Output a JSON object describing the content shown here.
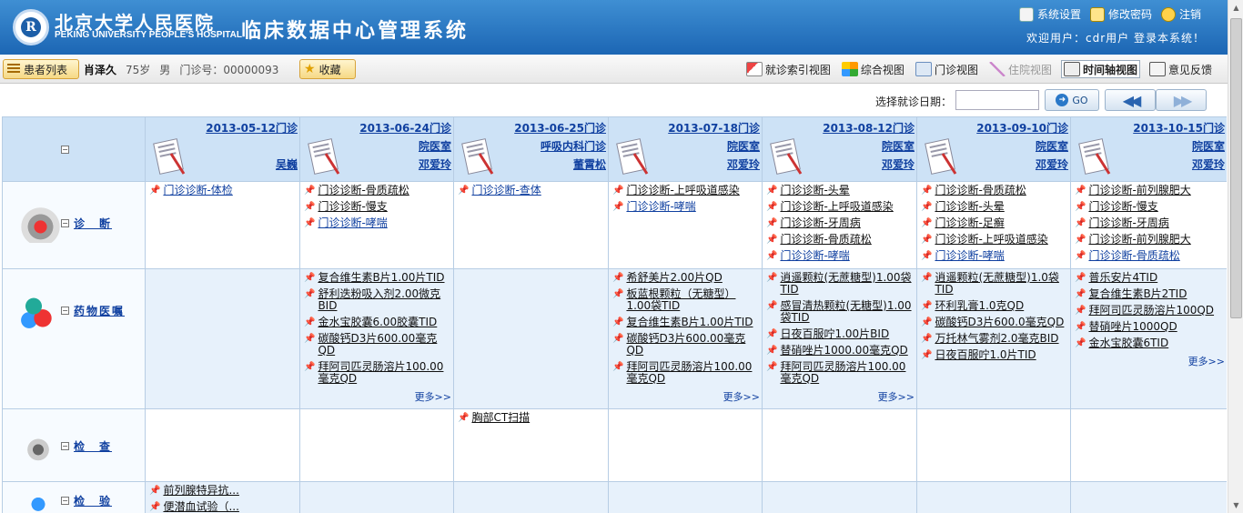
{
  "header": {
    "hospital_cn": "北京大学人民医院",
    "hospital_en": "PEKING UNIVERSITY PEOPLE'S HOSPITAL",
    "system_title": "临床数据中心管理系统",
    "links": [
      {
        "label": "系统设置",
        "icon": "settings-icon"
      },
      {
        "label": "修改密码",
        "icon": "edit-password-icon"
      },
      {
        "label": "注销",
        "icon": "logout-icon"
      }
    ],
    "welcome": "欢迎用户：cdr用户 登录本系统！"
  },
  "patient_bar": {
    "list_button": "患者列表",
    "name": "肖泽久",
    "age": "75岁",
    "sex": "男",
    "outpatient_no": "门诊号：00000093",
    "favorite_button": "收藏"
  },
  "views": [
    {
      "label": "就诊索引视图",
      "icon": "index-view-icon",
      "state": "normal"
    },
    {
      "label": "综合视图",
      "icon": "overview-icon",
      "state": "normal"
    },
    {
      "label": "门诊视图",
      "icon": "outpatient-view-icon",
      "state": "normal"
    },
    {
      "label": "住院视图",
      "icon": "inpatient-view-icon",
      "state": "disabled"
    },
    {
      "label": "时间轴视图",
      "icon": "timeline-view-icon",
      "state": "active"
    },
    {
      "label": "意见反馈",
      "icon": "feedback-icon",
      "state": "normal"
    }
  ],
  "date_bar": {
    "label": "选择就诊日期：",
    "date_value": "",
    "go_label": "GO"
  },
  "timeline": {
    "visits": [
      {
        "date": "2013-05-12门诊",
        "dept": "",
        "doctor": "吴巍"
      },
      {
        "date": "2013-06-24门诊",
        "dept": "院医室",
        "doctor": "邓爱玲"
      },
      {
        "date": "2013-06-25门诊",
        "dept": "呼吸内科门诊",
        "doctor": "董霄松"
      },
      {
        "date": "2013-07-18门诊",
        "dept": "院医室",
        "doctor": "邓爱玲"
      },
      {
        "date": "2013-08-12门诊",
        "dept": "院医室",
        "doctor": "邓爱玲"
      },
      {
        "date": "2013-09-10门诊",
        "dept": "院医室",
        "doctor": "邓爱玲"
      },
      {
        "date": "2013-10-15门诊",
        "dept": "院医室",
        "doctor": "邓爱玲"
      }
    ],
    "rows": [
      {
        "label": "诊　断",
        "icon": "diagnosis-icon",
        "cells": [
          {
            "items": [
              "门诊诊断-体检"
            ]
          },
          {
            "items": [
              "门诊诊断-骨质疏松",
              "门诊诊断-慢支",
              "门诊诊断-哮喘"
            ]
          },
          {
            "items": [
              "门诊诊断-查体"
            ]
          },
          {
            "items": [
              "门诊诊断-上呼吸道感染",
              "门诊诊断-哮喘"
            ]
          },
          {
            "items": [
              "门诊诊断-头晕",
              "门诊诊断-上呼吸道感染",
              "门诊诊断-牙周病",
              "门诊诊断-骨质疏松",
              "门诊诊断-哮喘"
            ]
          },
          {
            "items": [
              "门诊诊断-骨质疏松",
              "门诊诊断-头晕",
              "门诊诊断-足癣",
              "门诊诊断-上呼吸道感染",
              "门诊诊断-哮喘"
            ]
          },
          {
            "items": [
              "门诊诊断-前列腺肥大",
              "门诊诊断-慢支",
              "门诊诊断-牙周病",
              "门诊诊断-前列腺肥大",
              "门诊诊断-骨质疏松"
            ]
          }
        ]
      },
      {
        "label": "药物医嘱",
        "icon": "medication-icon",
        "cells": [
          {
            "items": []
          },
          {
            "items": [
              "复合维生素B片1.00片TID",
              "舒利迭粉吸入剂2.00微克BID",
              "金水宝胶囊6.00胶囊TID",
              "碳酸钙D3片600.00毫克QD",
              "拜阿司匹灵肠溶片100.00毫克QD"
            ],
            "more": "更多>>"
          },
          {
            "items": []
          },
          {
            "items": [
              "希舒美片2.00片QD",
              "板蓝根颗粒（无糖型）1.00袋TID",
              "复合维生素B片1.00片TID",
              "碳酸钙D3片600.00毫克QD",
              "拜阿司匹灵肠溶片100.00毫克QD"
            ],
            "more": "更多>>"
          },
          {
            "items": [
              "逍遥颗粒(无蔗糖型)1.00袋TID",
              "感冒清热颗粒(无糖型)1.00袋TID",
              "日夜百服咛1.00片BID",
              "替硝唑片1000.00毫克QD",
              "拜阿司匹灵肠溶片100.00毫克QD"
            ],
            "more": "更多>>"
          },
          {
            "items": [
              "逍遥颗粒(无蔗糖型)1.0袋TID",
              "环利乳膏1.0克QD",
              "碳酸钙D3片600.0毫克QD",
              "万托林气雾剂2.0毫克BID",
              "日夜百服咛1.0片TID"
            ]
          },
          {
            "items": [
              "普乐安片4TID",
              "复合维生素B片2TID",
              "拜阿司匹灵肠溶片100QD",
              "替硝唑片1000QD",
              "金水宝胶囊6TID"
            ],
            "more": "更多>>"
          }
        ]
      },
      {
        "label": "检　查",
        "icon": "examination-icon",
        "cells": [
          {
            "items": []
          },
          {
            "items": []
          },
          {
            "items": [
              "胸部CT扫描"
            ]
          },
          {
            "items": []
          },
          {
            "items": []
          },
          {
            "items": []
          },
          {
            "items": []
          }
        ]
      },
      {
        "label": "检　验",
        "icon": "lab-test-icon",
        "cells": [
          {
            "items": [
              "前列腺特异抗...",
              "便潜血试验（..."
            ]
          },
          {
            "items": []
          },
          {
            "items": []
          },
          {
            "items": []
          },
          {
            "items": []
          },
          {
            "items": []
          },
          {
            "items": []
          }
        ]
      }
    ]
  }
}
